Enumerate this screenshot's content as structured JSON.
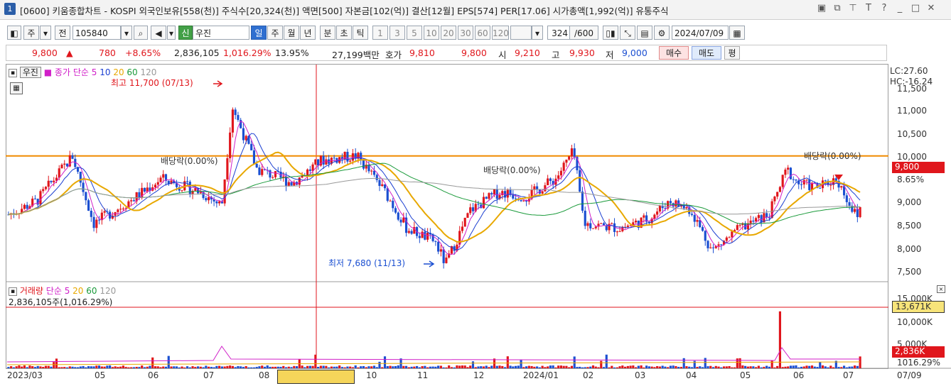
{
  "window": {
    "number": "1",
    "title": "[0600] 키움종합차트 - KOSPI 외국인보유[558(천)] 주식수[20,324(천)] 액면[500] 자본금[102(억)] 결산[12월] EPS[574] PER[17.06] 시가총액[1,992(억)] 유통주식",
    "icons": [
      "layout-icon",
      "copy-icon",
      "pin-icon",
      "font-icon",
      "help-icon",
      "minimize-icon",
      "maximize-icon",
      "close-icon"
    ]
  },
  "toolbar": {
    "type_label": "주",
    "prev_label": "전",
    "code": "105840",
    "new_badge": "신",
    "stock_name": "우진",
    "periods": [
      "일",
      "주",
      "월",
      "년",
      "분",
      "초",
      "틱"
    ],
    "active_period": "일",
    "minute_steps": [
      "1",
      "3",
      "5",
      "10",
      "20",
      "30",
      "60",
      "120"
    ],
    "count": "324",
    "count_max": "/600",
    "date": "2024/07/09"
  },
  "price_bar": {
    "price": "9,800",
    "arrow": "▲",
    "change": "780",
    "change_pct": "+8.65%",
    "volume": "2,836,105",
    "volume_pct": "1,016.29%",
    "turnover": "13.95%",
    "amount": "27,199백만",
    "bid_label": "호가",
    "ask": "9,810",
    "bid": "9,800",
    "open_label": "시",
    "open": "9,210",
    "high_label": "고",
    "high": "9,930",
    "low_label": "저",
    "low": "9,000",
    "buy_label": "매수",
    "sell_label": "매도",
    "avg_label": "평"
  },
  "price_panel": {
    "stock_tag": "우진",
    "ma_title": "종가 단순",
    "ma_periods": [
      "5",
      "10",
      "20",
      "60",
      "120"
    ],
    "ma_colors": [
      "#d01fc8",
      "#1b3fd1",
      "#e8a800",
      "#1a9a3a",
      "#999999"
    ],
    "max_label": "최고 11,700 (07/13)",
    "min_label": "최저 7,680 (11/13)",
    "dividend_labels": [
      "배당락(0.00%)",
      "배당락(0.00%)",
      "배당락(0.00%)"
    ],
    "lc": "LC:27.60",
    "hc": "HC:-16.24",
    "current_tag": "9,800",
    "current_pct": "8.65%",
    "y_ticks": [
      "11,500",
      "11,000",
      "10,500",
      "10,000",
      "9,500",
      "9,000",
      "8,500",
      "8,000",
      "7,500"
    ]
  },
  "volume_panel": {
    "title": "거래량",
    "ma_title": "단순",
    "ma_periods": [
      "5",
      "20",
      "60",
      "120"
    ],
    "today": "2,836,105주(1,016.29%)",
    "y_ticks": [
      "15,000K",
      "10,000K",
      "5,000K"
    ],
    "tag_high": "13,671K",
    "tag_now": "2,836K",
    "tag_pct": "1016.29%"
  },
  "x_axis": {
    "labels": [
      "2023/03",
      "05",
      "06",
      "07",
      "08",
      "10",
      "11",
      "12",
      "2024/01",
      "02",
      "03",
      "04",
      "05",
      "06",
      "07"
    ],
    "right_label": "07/09"
  },
  "chart_data": {
    "type": "candlestick",
    "ylim": [
      7500,
      11700
    ],
    "max": {
      "value": 11700,
      "date": "07/13"
    },
    "min": {
      "value": 7680,
      "date": "11/13"
    },
    "current": 9800,
    "horizontal_line": 10100
  }
}
